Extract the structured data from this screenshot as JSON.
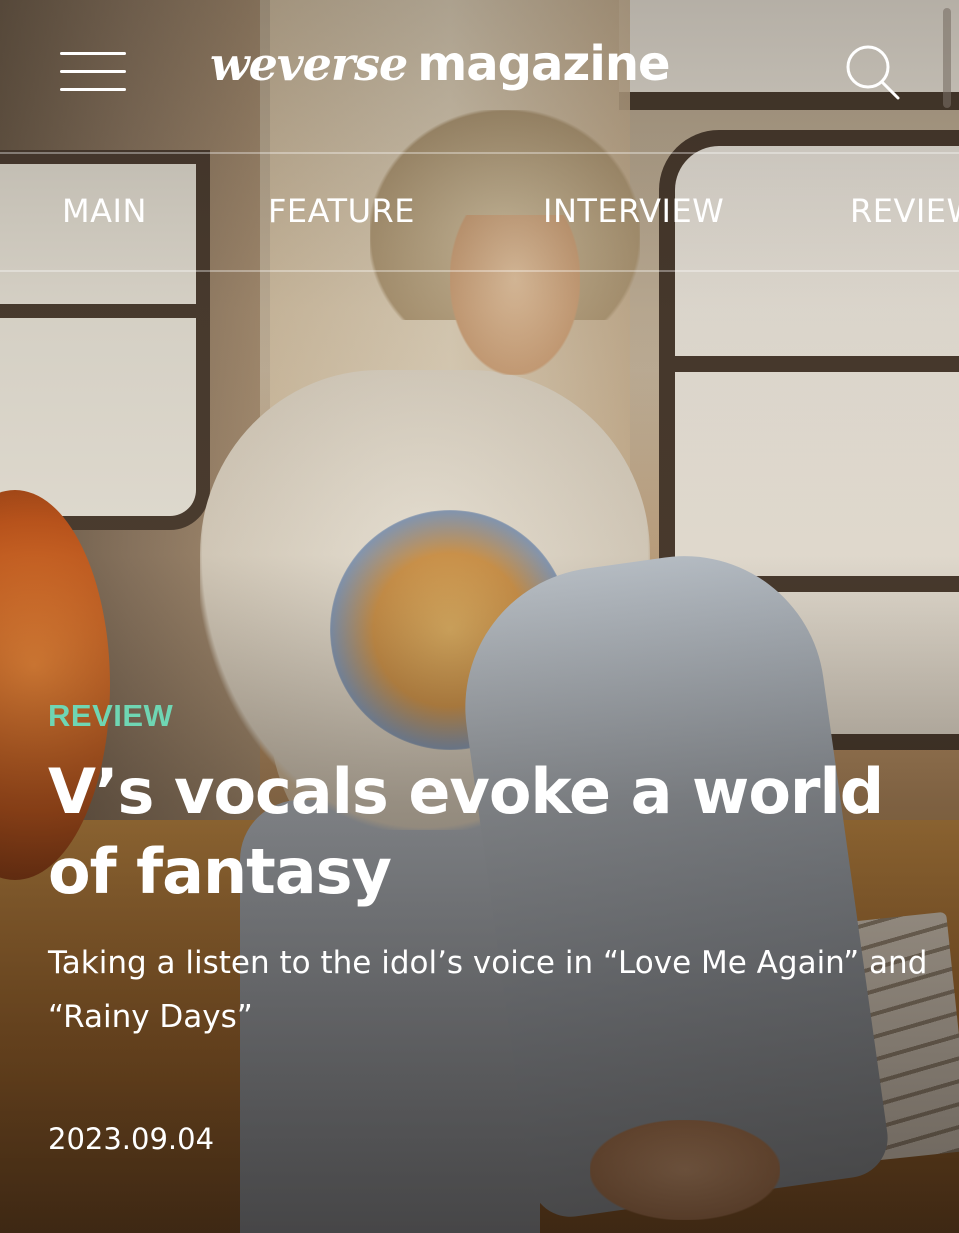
{
  "header": {
    "logo_brand": "weverse",
    "logo_sub": "magazine",
    "menu_icon": "hamburger-menu-icon",
    "search_icon": "search-icon"
  },
  "nav": {
    "items": [
      {
        "label": "MAIN"
      },
      {
        "label": "FEATURE"
      },
      {
        "label": "INTERVIEW"
      },
      {
        "label": "REVIEW"
      }
    ]
  },
  "article": {
    "category": "REVIEW",
    "title": "V’s vocals evoke a world of fantasy",
    "subtitle": "Taking a listen to the idol’s voice in “Love Me Again” and “Rainy Days”",
    "date": "2023.09.04"
  },
  "colors": {
    "category_accent": "#6fd6b3",
    "text": "#ffffff"
  }
}
